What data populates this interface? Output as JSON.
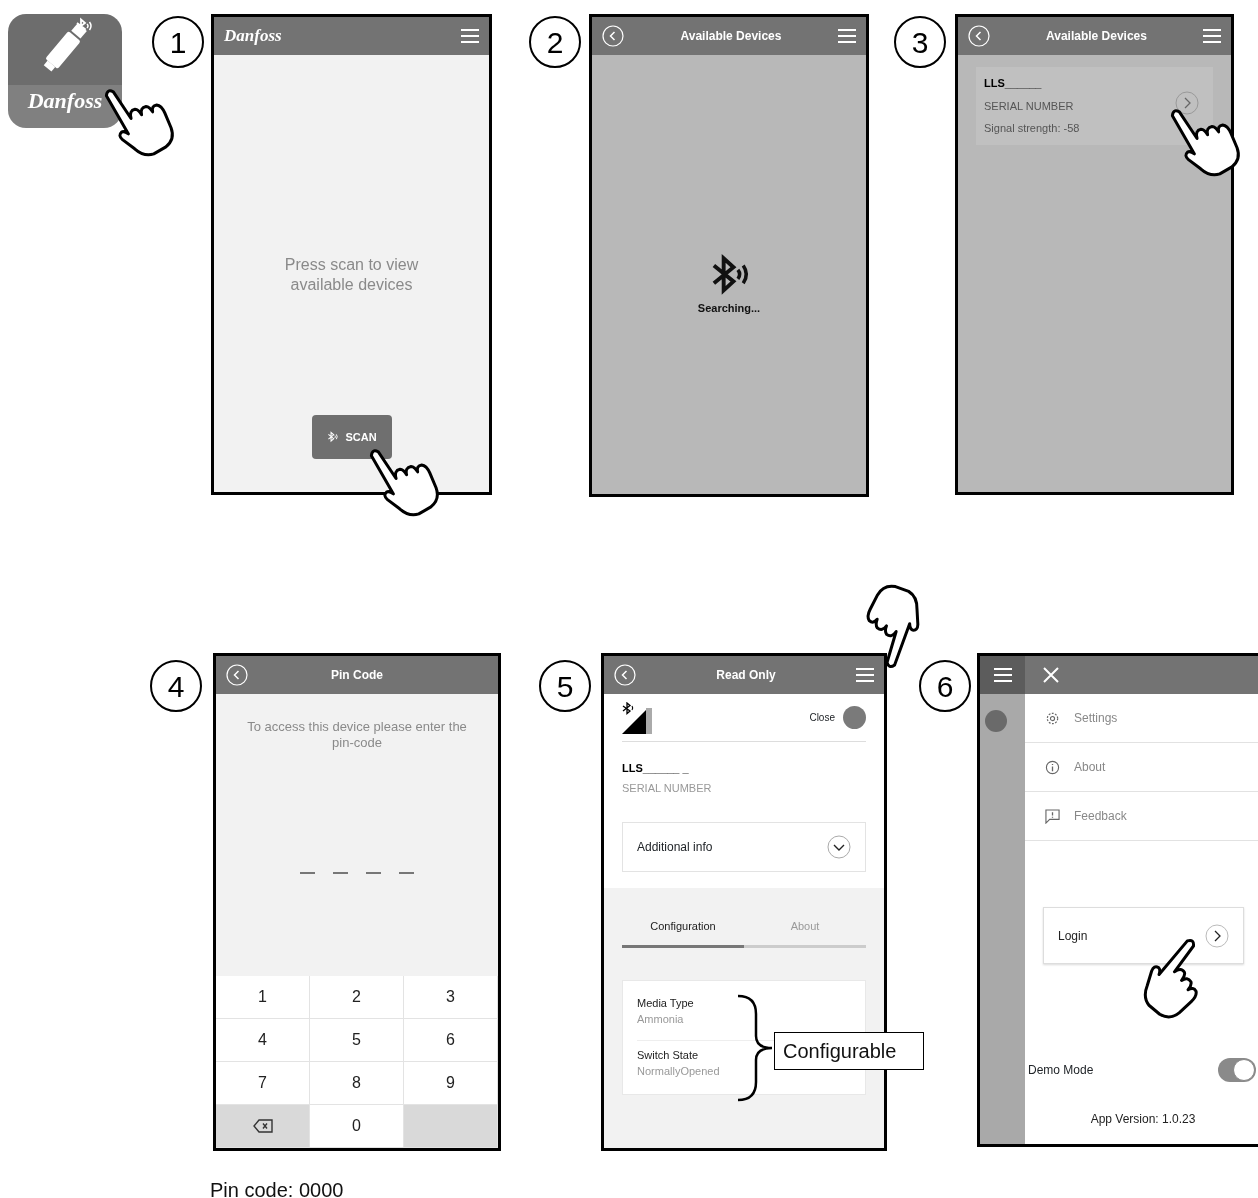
{
  "app_icon": {
    "logo": "Danfoss"
  },
  "steps": [
    {
      "number": "1",
      "kind": "scan",
      "logo": "Danfoss",
      "message": "Press scan to view available devices",
      "scan_button": "SCAN"
    },
    {
      "number": "2",
      "kind": "searching",
      "title": "Available Devices",
      "status": "Searching..."
    },
    {
      "number": "3",
      "kind": "devices",
      "title": "Available Devices",
      "device": {
        "name": "LLS______",
        "serial": "SERIAL NUMBER",
        "signal": "Signal strength: -58"
      }
    },
    {
      "number": "4",
      "kind": "pin",
      "title": "Pin Code",
      "prompt": "To access this device please enter the pin-code",
      "keys": [
        {
          "kind": "digit",
          "label": "1"
        },
        {
          "kind": "digit",
          "label": "2"
        },
        {
          "kind": "digit",
          "label": "3"
        },
        {
          "kind": "digit",
          "label": "4"
        },
        {
          "kind": "digit",
          "label": "5"
        },
        {
          "kind": "digit",
          "label": "6"
        },
        {
          "kind": "digit",
          "label": "7"
        },
        {
          "kind": "digit",
          "label": "8"
        },
        {
          "kind": "digit",
          "label": "9"
        },
        {
          "kind": "backspace"
        },
        {
          "kind": "digit",
          "label": "0"
        },
        {
          "kind": "blank"
        }
      ],
      "note": "Pin code: 0000"
    },
    {
      "number": "5",
      "kind": "device",
      "title": "Read Only",
      "close_label": "Close",
      "device_name": "LLS______ _",
      "serial": "SERIAL NUMBER",
      "accordion": {
        "label": "Additional info",
        "expanded": false
      },
      "tabs": [
        {
          "label": "Configuration",
          "selected": true
        },
        {
          "label": "About",
          "selected": false
        }
      ],
      "fields": [
        {
          "label": "Media Type",
          "value": "Ammonia"
        },
        {
          "label": "Switch State",
          "value": "NormallyOpened"
        }
      ],
      "callout": "Configurable"
    },
    {
      "number": "6",
      "kind": "menu",
      "menu_items": [
        {
          "label": "Settings"
        },
        {
          "label": "About"
        },
        {
          "label": "Feedback"
        }
      ],
      "login": "Login",
      "demo_mode": {
        "label": "Demo Mode",
        "on": true
      },
      "version": "App Version: 1.0.23"
    }
  ]
}
